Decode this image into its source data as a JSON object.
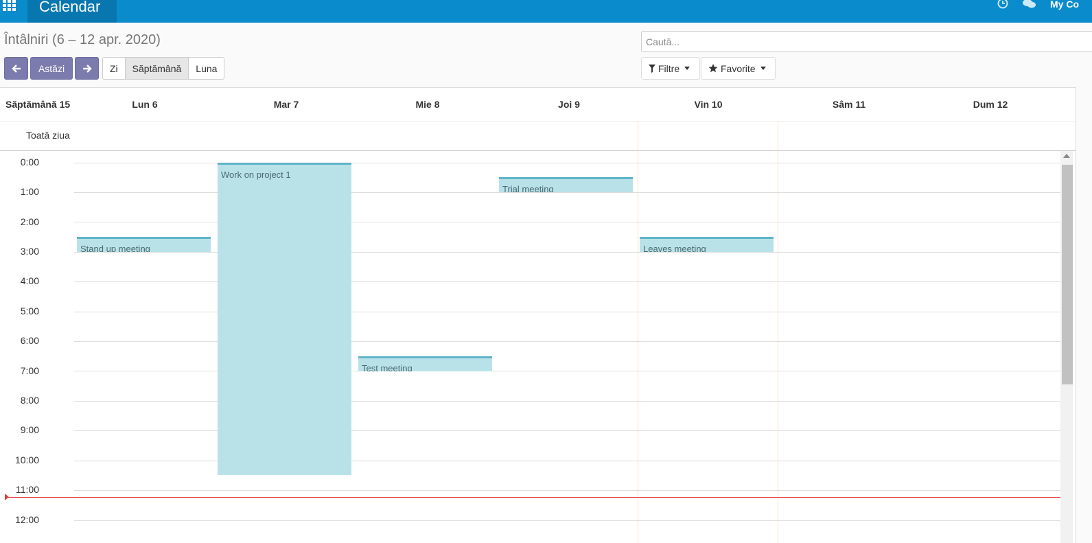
{
  "navbar": {
    "brand": "Calendar",
    "company": "My Co",
    "apps_icon": "apps-grid-icon",
    "clock_icon": "clock-icon",
    "chat_icon": "chat-icon",
    "color": "#0a8bcc"
  },
  "control_panel": {
    "title": "Întâlniri (6 – 12 apr. 2020)",
    "today_label": "Astăzi",
    "prev_icon": "arrow-left-icon",
    "next_icon": "arrow-right-icon",
    "scales": [
      "Zi",
      "Săptămână",
      "Luna"
    ],
    "active_scale": "Săptămână",
    "search_placeholder": "Caută...",
    "filters_label": "Filtre",
    "favorites_label": "Favorite"
  },
  "calendar": {
    "week_label": "Săptămână 15",
    "days": [
      "Lun 6",
      "Mar 7",
      "Mie 8",
      "Joi 9",
      "Vin 10",
      "Sâm 11",
      "Dum 12"
    ],
    "allday_label": "Toată ziua",
    "hours": [
      "0:00",
      "1:00",
      "2:00",
      "3:00",
      "4:00",
      "5:00",
      "6:00",
      "7:00",
      "8:00",
      "9:00",
      "10:00",
      "11:00",
      "12:00"
    ],
    "events": [
      {
        "title": "Stand up meeting",
        "day": 0,
        "start": "2:30",
        "end": "3:00"
      },
      {
        "title": "Work on project 1",
        "day": 1,
        "start": "0:00",
        "end": "10:30"
      },
      {
        "title": "Test meeting",
        "day": 2,
        "start": "6:30",
        "end": "7:00"
      },
      {
        "title": "Trial meeting",
        "day": 3,
        "start": "0:30",
        "end": "1:00"
      },
      {
        "title": "Leaves meeting",
        "day": 4,
        "start": "2:30",
        "end": "3:00"
      }
    ],
    "event_color": "#b9e2e8",
    "now_line_color": "#e23c3c"
  }
}
